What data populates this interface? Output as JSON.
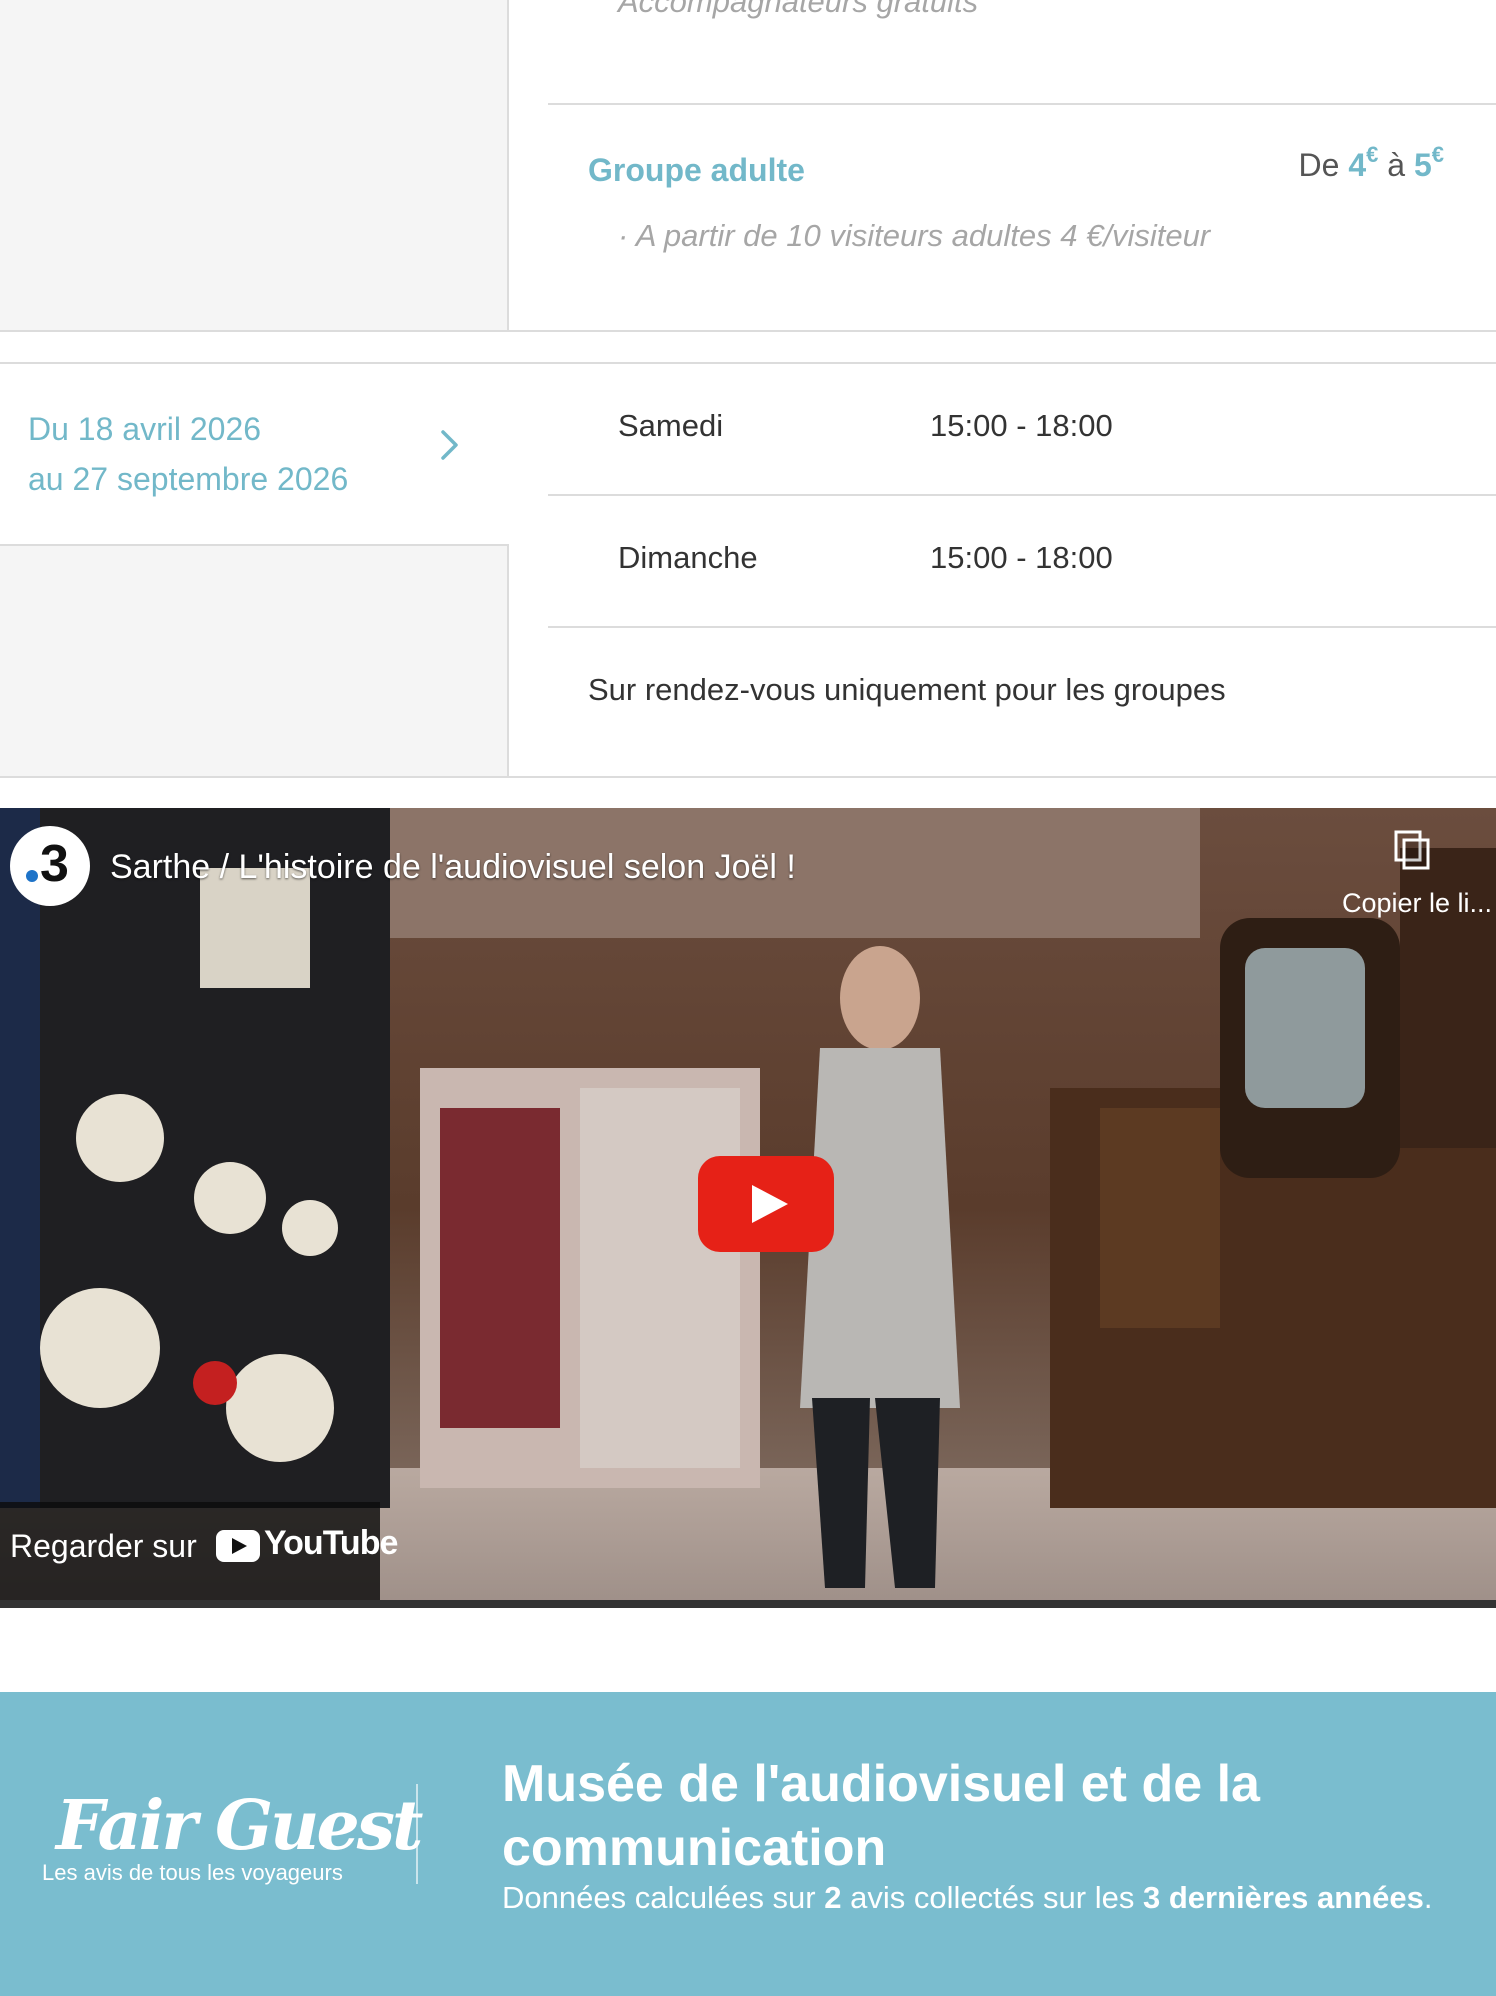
{
  "pricing": {
    "companion_note": "Accompagnateurs gratuits",
    "group": {
      "label": "Groupe adulte",
      "price_from_word": "De",
      "price_min": "4",
      "currency": "€",
      "price_to_word": "à",
      "price_max": "5",
      "note": "· A partir de 10 visiteurs adultes 4 €/visiteur"
    }
  },
  "schedule": {
    "range_start": "Du 18 avril 2026",
    "range_end": "au 27 septembre 2026",
    "rows": [
      {
        "day": "Samedi",
        "hours": "15:00 - 18:00"
      },
      {
        "day": "Dimanche",
        "hours": "15:00 - 18:00"
      }
    ],
    "note": "Sur rendez-vous uniquement pour les groupes"
  },
  "video": {
    "channel_logo": "3",
    "title": "Sarthe / L'histoire de l'audiovisuel selon Joël !",
    "copy_link_label": "Copier le li...",
    "watch_on": "Regarder sur",
    "platform": "YouTube"
  },
  "fairguest": {
    "logo": "Fair Guest",
    "tagline": "Les avis de tous les voyageurs",
    "title": "Musée de l'audiovisuel et de la communication",
    "stats_1": "Données calculées sur ",
    "review_count": "2",
    "stats_2": " avis collectés sur les ",
    "period": "3 dernières années",
    "stats_3": "."
  },
  "colors": {
    "accent": "#72b8c9",
    "footer_bg": "#7abdcf",
    "play_button": "#e62117"
  }
}
